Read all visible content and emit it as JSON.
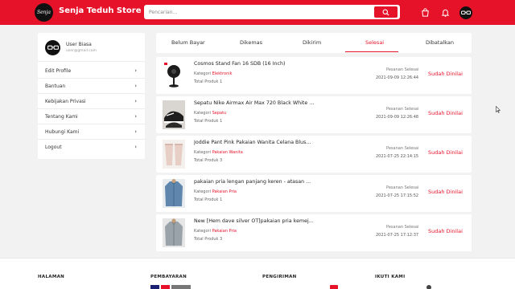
{
  "header": {
    "logo_text": "Senja",
    "store_name": "Senja Teduh Store",
    "search_placeholder": "Pencarian..."
  },
  "user": {
    "name": "User Biasa",
    "email": "user@gmail.com"
  },
  "menu": [
    {
      "label": "Edit Profile",
      "chevron": "›"
    },
    {
      "label": "Bantuan",
      "chevron": "›"
    },
    {
      "label": "Kebijakan Privasi",
      "chevron": "›"
    },
    {
      "label": "Tentang Kami",
      "chevron": "›"
    },
    {
      "label": "Hubungi Kami",
      "chevron": "›"
    },
    {
      "label": "Logout",
      "chevron": "›"
    }
  ],
  "tabs": [
    {
      "label": "Belum Bayar"
    },
    {
      "label": "Dikemas"
    },
    {
      "label": "Dikirim"
    },
    {
      "label": "Selesai",
      "active": true
    },
    {
      "label": "Dibatalkan"
    }
  ],
  "orders": [
    {
      "name": "Cosmos Stand Fan 16 SDB (16 Inch)",
      "category_label": "Kategori",
      "category": "Elektronik",
      "qty": "Total Produk 1",
      "status_label": "Pesanan Selesai",
      "date": "2021-09-09 12:26:44",
      "action": "Sudah Dinilai",
      "thumb": "fan"
    },
    {
      "name": "Sepatu Nike Airmax Air Max 720 Black White P...",
      "category_label": "Kategori",
      "category": "Sepatu",
      "qty": "Total Produk 1",
      "status_label": "Pesanan Selesai",
      "date": "2021-09-09 12:26:48",
      "action": "Sudah Dinilai",
      "thumb": "shoe"
    },
    {
      "name": "Joddie Pant Pink Pakaian Wanita Celana Blus...",
      "category_label": "Kategori",
      "category": "Pakaian Wanita",
      "qty": "Total Produk 3",
      "status_label": "Pesanan Selesai",
      "date": "2021-07-25 22:14:15",
      "action": "Sudah Dinilai",
      "thumb": "pants"
    },
    {
      "name": "pakaian pria lengan panjang keren - atasan ...",
      "category_label": "Kategori",
      "category": "Pakaian Pria",
      "qty": "Total Produk 1",
      "status_label": "Pesanan Selesai",
      "date": "2021-07-25 17:15:52",
      "action": "Sudah Dinilai",
      "thumb": "denim-shirt"
    },
    {
      "name": "New [Hem dave silver OT]pakaian pria kemej...",
      "category_label": "Kategori",
      "category": "Pakaian Pria",
      "qty": "Total Produk 3",
      "status_label": "Pesanan Selesai",
      "date": "2021-07-25 17:12:37",
      "action": "Sudah Dinilai",
      "thumb": "grey-shirt"
    }
  ],
  "footer": {
    "halaman": "HALAMAN",
    "pembayaran": "PEMBAYARAN",
    "pengiriman": "PENGIRIMAN",
    "ikuti_kami": "IKUTI KAMI"
  },
  "colors": {
    "accent": "#e5122a",
    "background": "#f2f2f2"
  }
}
